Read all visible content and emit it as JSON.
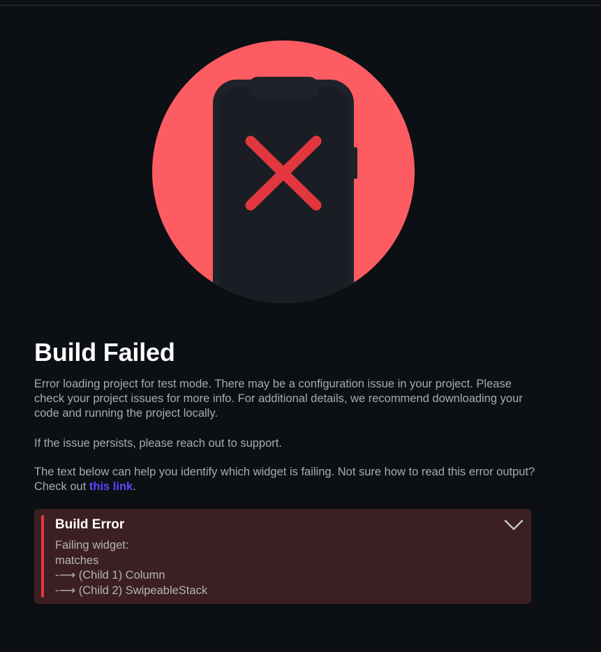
{
  "illustration": {
    "icon": "phone-error-icon",
    "circle_color": "#fd5c62",
    "phone_color": "#1e2229",
    "cross_color": "#e2373e"
  },
  "title": "Build Failed",
  "paragraphs": {
    "config": "Error loading project for test mode. There may be a configuration issue in your project. Please check your project issues for more info. For additional details, we recommend downloading your code and running the project locally.",
    "support": "If the issue persists, please reach out to support.",
    "help_prefix": "The text below can help you identify which widget is failing. Not sure how to read this error output? Check out ",
    "help_link": "this link",
    "help_suffix": "."
  },
  "build_error": {
    "title": "Build Error",
    "icon": "chevron-down-icon",
    "lines": [
      "Failing widget:",
      "matches",
      "-⟶ (Child 1) Column",
      "-⟶ (Child 2) SwipeableStack"
    ]
  },
  "colors": {
    "background": "#0c1014",
    "link": "#5a45ff",
    "error_panel": "#3c1f22",
    "error_accent": "#e5373d"
  }
}
